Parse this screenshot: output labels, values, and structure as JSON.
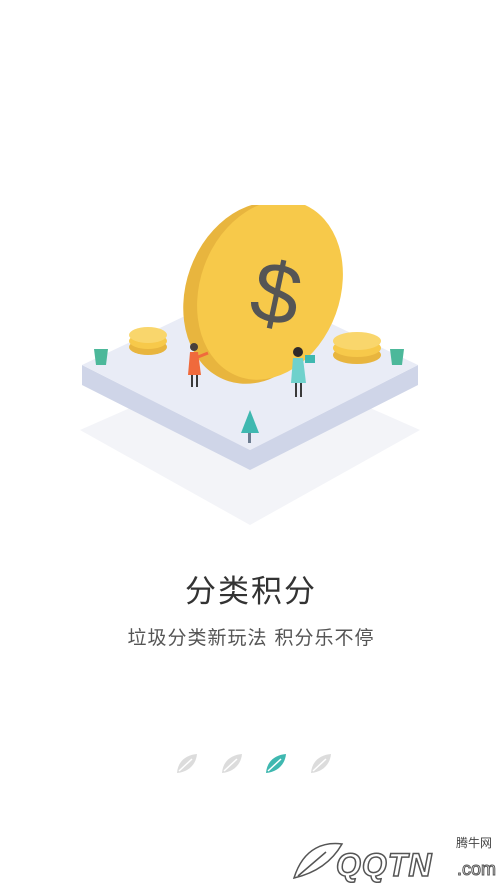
{
  "onboarding": {
    "title": "分类积分",
    "subtitle": "垃圾分类新玩法 积分乐不停",
    "page_count": 4,
    "active_page": 3,
    "accent_color": "#3fb8b0",
    "inactive_color": "#dcdcdc"
  },
  "illustration": {
    "coin_symbol": "$",
    "coin_color": "#f7c94a",
    "platform_color": "#e9ecf6"
  },
  "watermark": {
    "site": "腾牛网",
    "brand": "QQTN",
    "suffix": ".com"
  }
}
